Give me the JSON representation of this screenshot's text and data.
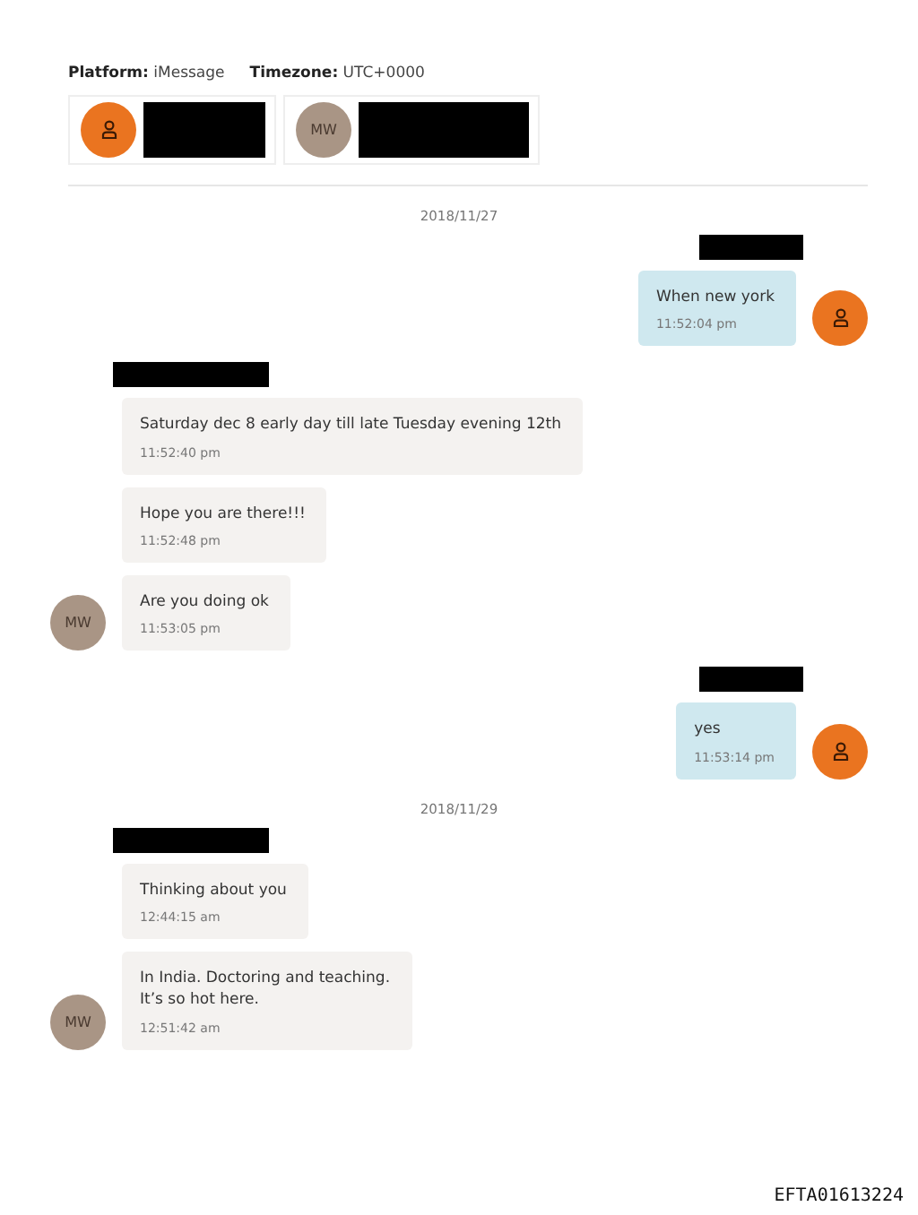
{
  "header": {
    "platform_label": "Platform:",
    "platform": "iMessage",
    "timezone_label": "Timezone:",
    "timezone": "UTC+0000"
  },
  "participants": [
    {
      "avatar": {
        "kind": "icon"
      },
      "name_redacted": true
    },
    {
      "avatar": {
        "kind": "initials",
        "initials": "MW"
      },
      "name_redacted": true
    }
  ],
  "days": [
    {
      "date": "2018/11/27",
      "groups": [
        {
          "kind": "sent",
          "name_redacted": true,
          "avatar": {
            "kind": "icon"
          },
          "messages": [
            {
              "text": "When new york",
              "time": "11:52:04 pm"
            }
          ]
        },
        {
          "kind": "received",
          "name_redacted": true,
          "avatar": {
            "kind": "initials",
            "initials": "MW"
          },
          "messages": [
            {
              "text": "Saturday dec 8 early day till late Tuesday evening 12th",
              "time": "11:52:40 pm"
            },
            {
              "text": "Hope you are there!!!",
              "time": "11:52:48 pm"
            },
            {
              "text": "Are you doing ok",
              "time": "11:53:05 pm"
            }
          ]
        },
        {
          "kind": "sent",
          "name_redacted": true,
          "avatar": {
            "kind": "icon"
          },
          "messages": [
            {
              "text": "yes",
              "time": "11:53:14 pm"
            }
          ]
        }
      ]
    },
    {
      "date": "2018/11/29",
      "groups": [
        {
          "kind": "received",
          "name_redacted": true,
          "avatar": {
            "kind": "initials",
            "initials": "MW"
          },
          "messages": [
            {
              "text": "Thinking about you",
              "time": "12:44:15 am"
            },
            {
              "text": "In India. Doctoring and teaching.\nIt’s so hot here.",
              "time": "12:51:42 am"
            }
          ]
        }
      ]
    }
  ],
  "document_id": "EFTA01613224"
}
